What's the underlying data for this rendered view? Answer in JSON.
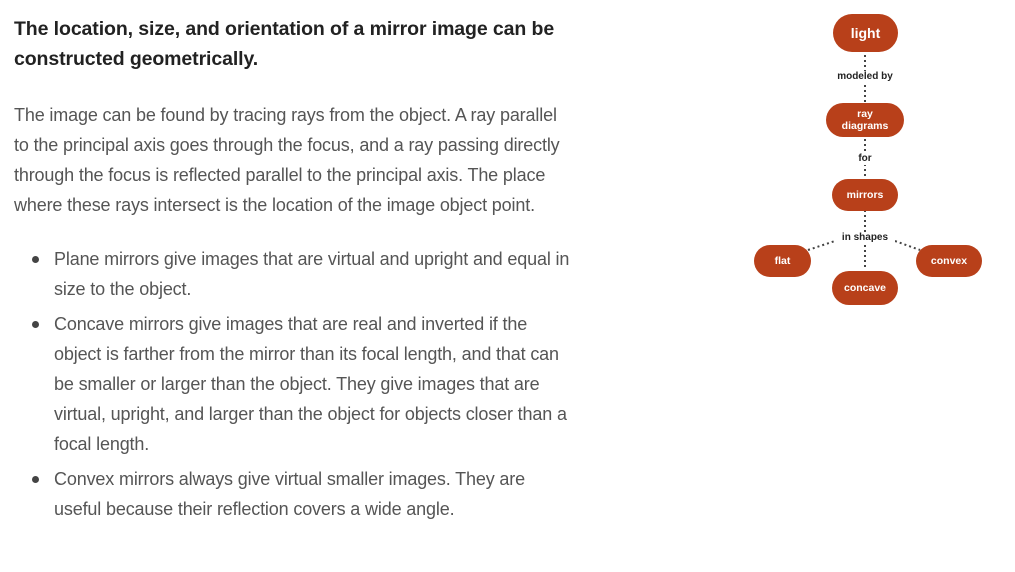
{
  "heading": "The location, size, and orientation of a mirror image can be constructed geometrically.",
  "paragraph": "The image can be found by tracing rays from the object. A ray parallel to the principal axis goes through the focus, and a ray passing directly through the focus is reflected parallel to the principal axis. The place where these rays intersect is the location of the image object point.",
  "bullets": [
    "Plane mirrors give images that are virtual and upright and equal in size to the object.",
    "Concave mirrors give images that are real and inverted if the object is farther from the mirror than its focal length, and that can be smaller or larger than the object. They give images that are virtual, upright, and larger than the object for objects closer than a focal length.",
    "Convex mirrors always give virtual smaller images. They are useful because their reflection covers a wide angle."
  ],
  "concept_map": {
    "node_color": "#b8401a",
    "nodes": {
      "light": "light",
      "ray_diagrams": "ray diagrams",
      "mirrors": "mirrors",
      "flat": "flat",
      "concave": "concave",
      "convex": "convex"
    },
    "links": {
      "modeled_by": "modeled by",
      "for": "for",
      "in_shapes": "in shapes"
    }
  }
}
